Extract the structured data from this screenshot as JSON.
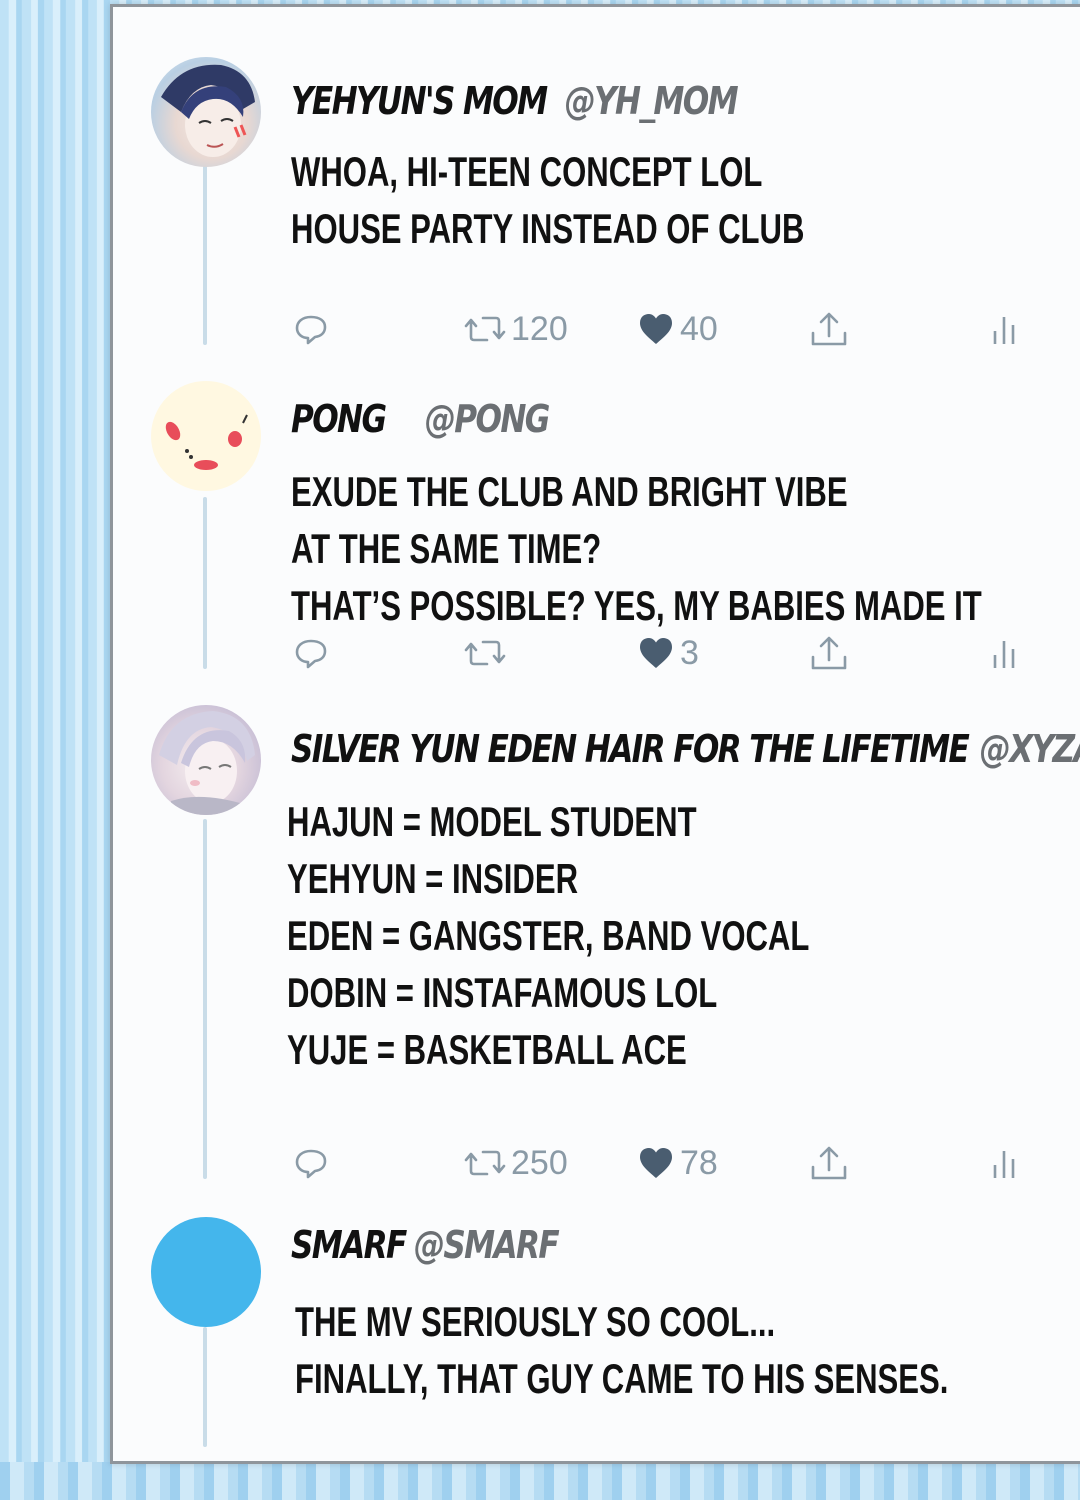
{
  "tweets": [
    {
      "name": "YEHYUN'S MOM",
      "handle": "@YH_MOM",
      "lines": [
        "WHOA, HI-TEEN CONCEPT LOL",
        "HOUSE PARTY INSTEAD OF CLUB"
      ],
      "retweets": "120",
      "likes": "40"
    },
    {
      "name": "PONG",
      "handle": "@PONG",
      "lines": [
        "EXUDE THE CLUB AND BRIGHT VIBE",
        "AT THE SAME TIME?",
        "THAT’S POSSIBLE? YES, MY BABIES MADE IT"
      ],
      "retweets": "",
      "likes": "3"
    },
    {
      "name": "SILVER YUN EDEN HAIR FOR THE LIFETIME",
      "handle": "@XYZA",
      "lines": [
        "HAJUN = MODEL STUDENT",
        "YEHYUN = INSIDER",
        "EDEN = GANGSTER, BAND VOCAL",
        "DOBIN = INSTAFAMOUS LOL",
        "YUJE = BASKETBALL ACE"
      ],
      "retweets": "250",
      "likes": "78"
    },
    {
      "name": "SMARF",
      "handle": "@SMARF",
      "lines": [
        "THE MV SERIOUSLY SO COOL...",
        "FINALLY, THAT GUY CAME TO HIS SENSES."
      ]
    }
  ],
  "icons": {
    "reply": "reply-icon",
    "retweet": "retweet-icon",
    "like": "heart-icon",
    "share": "share-icon",
    "stats": "analytics-icon"
  },
  "colors": {
    "heart": "#4a5d70",
    "icon": "#8a9aa6",
    "panel": "#fbfcfd",
    "thread": "#c9dce8",
    "smarf_avatar": "#44b6ec"
  }
}
